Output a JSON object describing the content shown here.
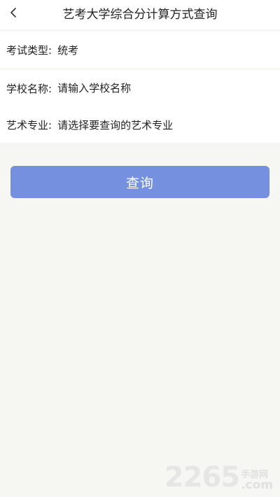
{
  "header": {
    "title": "艺考大学综合分计算方式查询",
    "back_icon": "chevron-left-icon"
  },
  "form": {
    "exam_type": {
      "label": "考试类型:",
      "value": "统考"
    },
    "school": {
      "label": "学校名称:",
      "placeholder": "请输入学校名称"
    },
    "major": {
      "label": "艺术专业:",
      "placeholder": "请选择要查询的艺术专业"
    }
  },
  "actions": {
    "query_label": "查询"
  },
  "watermark": {
    "digits": "2265",
    "cn": "手游网",
    "com": ".com"
  },
  "colors": {
    "background": "#f6f7f3",
    "button": "#7590df",
    "text": "#222222"
  }
}
